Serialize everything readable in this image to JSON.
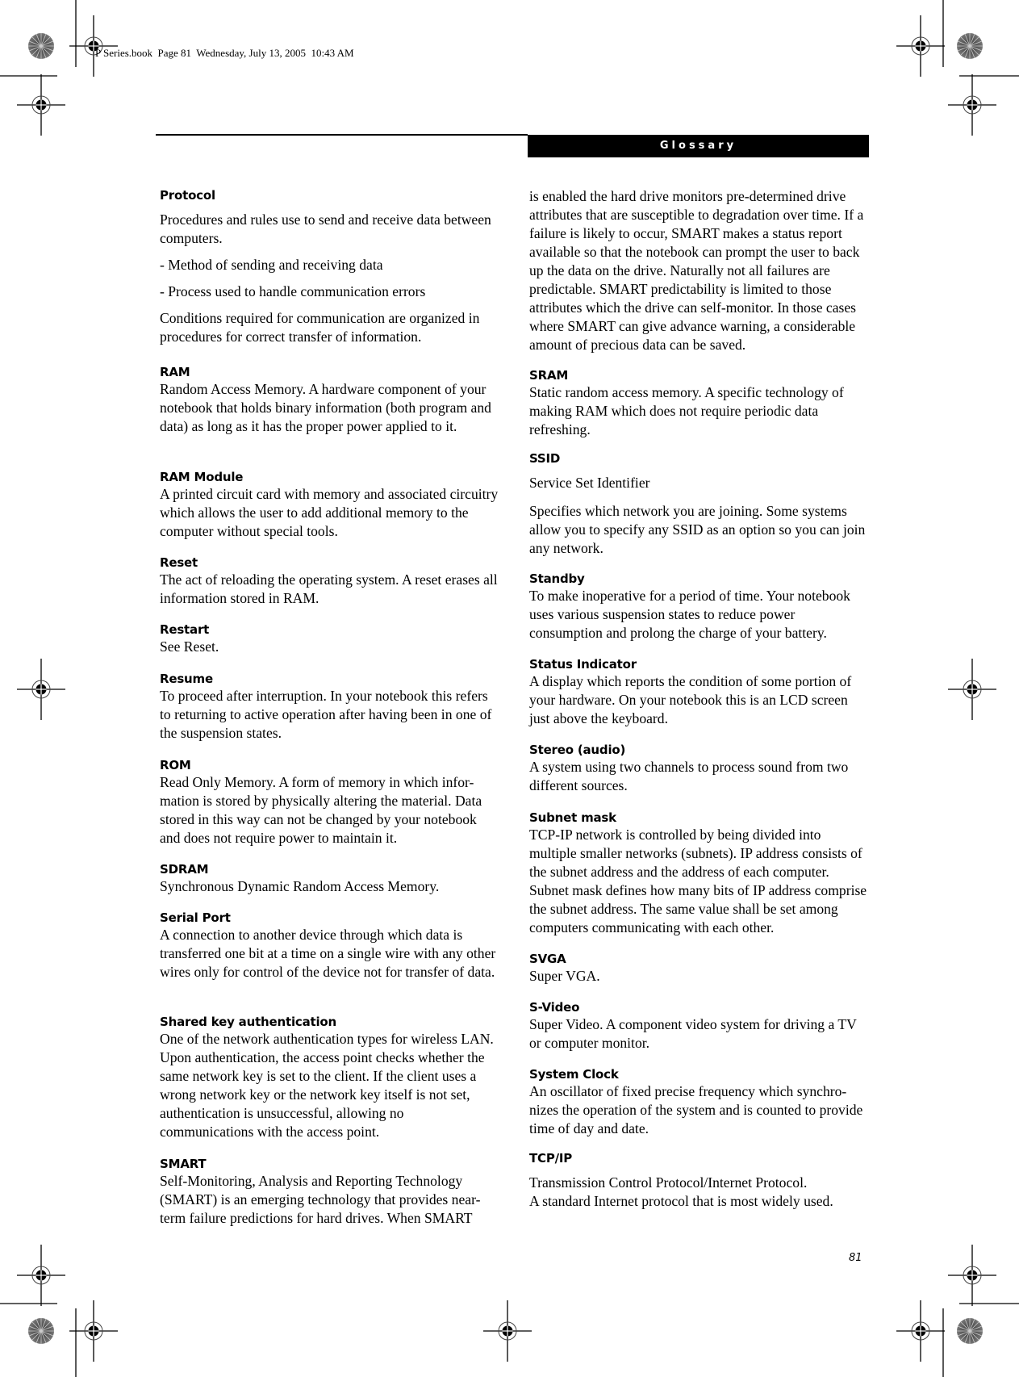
{
  "slug": "P Series.book  Page 81  Wednesday, July 13, 2005  10:43 AM",
  "header": {
    "section": "Glossary"
  },
  "page_number": "81",
  "left_column": [
    {
      "term": "Protocol",
      "paragraphs": [
        "Procedures and rules use to send and receive data between computers.",
        "- Method of sending and receiving data",
        "- Process used to handle communication errors",
        "Conditions required for communication are organized in procedures for correct transfer of information."
      ]
    },
    {
      "term": "RAM",
      "paragraphs": [
        "Random Access Memory. A hardware component of your notebook that holds binary information (both program and data) as long as it has the proper power applied to it."
      ]
    },
    {
      "term": "RAM Module",
      "paragraphs": [
        "A printed circuit card with memory and associated circuitry which allows the user to add additional memory to the computer without special tools."
      ]
    },
    {
      "term": "Reset",
      "paragraphs": [
        "The act of reloading the operating system. A reset erases all information stored in RAM."
      ]
    },
    {
      "term": "Restart",
      "paragraphs": [
        "See Reset."
      ]
    },
    {
      "term": "Resume",
      "paragraphs": [
        "To proceed after interruption. In your notebook this refers to returning to active operation after having been in one of the suspension states."
      ]
    },
    {
      "term": "ROM",
      "paragraphs": [
        "Read Only Memory. A form of memory in which infor-mation is stored by physically altering the material. Data stored in this way can not be changed by your notebook and does not require power to maintain it."
      ]
    },
    {
      "term": "SDRAM",
      "paragraphs": [
        "Synchronous Dynamic Random Access Memory."
      ]
    },
    {
      "term": "Serial Port",
      "paragraphs": [
        "A connection to another device through which data is transferred one bit at a time on a single wire with any other wires only for control of the device not for transfer of data."
      ]
    },
    {
      "term": "Shared key authentication",
      "paragraphs": [
        "One of the network authentication types for wireless LAN. Upon authentication, the access point checks whether the same network key is set to the client. If the client uses a wrong network key or the network key itself is not set, authentication is unsuccessful, allowing no communications with the access point."
      ]
    },
    {
      "term": "SMART",
      "paragraphs": [
        "Self-Monitoring, Analysis and Reporting Technology (SMART) is an emerging technology that provides near-term failure predictions for hard drives. When SMART"
      ]
    }
  ],
  "right_column": [
    {
      "term": "",
      "paragraphs": [
        "is enabled the hard drive monitors pre-determined drive attributes that are susceptible to degradation over time. If a failure is likely to occur, SMART makes a status report available so that the notebook can prompt the user to back up the data on the drive. Naturally not all failures are predictable. SMART predictability is limited to those attributes which the drive can self-monitor. In those cases where SMART can give advance warning, a considerable amount of precious data can be saved."
      ]
    },
    {
      "term": "SRAM",
      "paragraphs": [
        "Static random access memory. A specific technology of making RAM which does not require periodic data refreshing."
      ]
    },
    {
      "term": "SSID",
      "paragraphs": [
        "Service Set Identifier",
        "Specifies which network you are joining. Some systems allow you to specify any SSID as an option so you can join any network."
      ]
    },
    {
      "term": "Standby",
      "paragraphs": [
        "To make inoperative for a period of time. Your notebook uses various suspension states to reduce power consumption and prolong the charge of your battery."
      ]
    },
    {
      "term": "Status Indicator",
      "paragraphs": [
        "A display which reports the condition of some portion of your hardware. On your notebook this is an LCD screen just above the keyboard."
      ]
    },
    {
      "term": "Stereo (audio)",
      "paragraphs": [
        "A system using two channels to process sound from two different sources."
      ]
    },
    {
      "term": "Subnet mask",
      "paragraphs": [
        "TCP-IP network is controlled by being divided into multiple smaller networks (subnets). IP address consists of the subnet address and the address of each computer. Subnet mask defines how many bits of IP address comprise the subnet address. The same value shall be set among computers communicating with each other."
      ]
    },
    {
      "term": "SVGA",
      "paragraphs": [
        "Super VGA."
      ]
    },
    {
      "term": "S-Video",
      "paragraphs": [
        "Super Video. A component video system for driving a TV or computer monitor."
      ]
    },
    {
      "term": "System Clock",
      "paragraphs": [
        "An oscillator of fixed precise frequency which synchro-nizes the operation of the system and is counted to provide time of day and date."
      ]
    },
    {
      "term": "TCP/IP",
      "paragraphs": [
        "Transmission Control Protocol/Internet Protocol.",
        "A standard Internet protocol that is most widely used."
      ]
    }
  ]
}
